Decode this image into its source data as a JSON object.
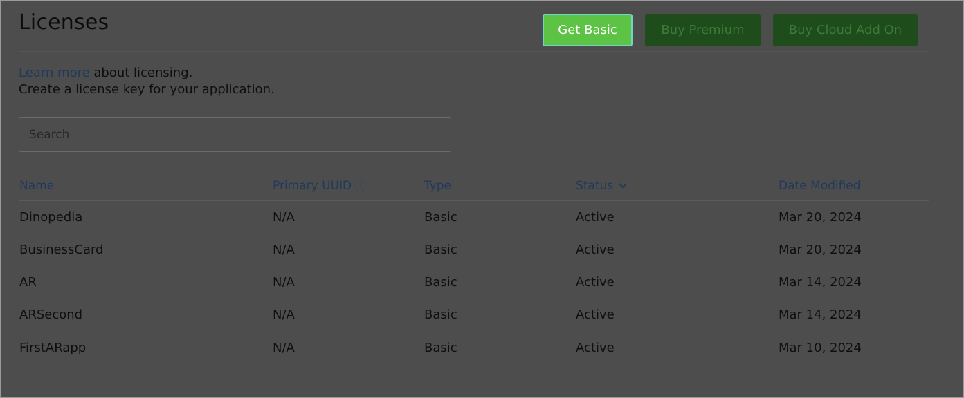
{
  "header": {
    "title": "Licenses",
    "buttons": {
      "get_basic": "Get Basic",
      "buy_premium": "Buy Premium",
      "buy_cloud": "Buy Cloud Add On"
    }
  },
  "intro": {
    "link_text": "Learn more",
    "line1_rest": " about licensing.",
    "line2": "Create a license key for your application."
  },
  "search": {
    "placeholder": "Search",
    "value": ""
  },
  "table": {
    "columns": {
      "name": "Name",
      "uuid": "Primary UUID",
      "type": "Type",
      "status": "Status",
      "date": "Date Modified"
    },
    "rows": [
      {
        "name": "Dinopedia",
        "uuid": "N/A",
        "type": "Basic",
        "status": "Active",
        "date": "Mar 20, 2024"
      },
      {
        "name": "BusinessCard",
        "uuid": "N/A",
        "type": "Basic",
        "status": "Active",
        "date": "Mar 20, 2024"
      },
      {
        "name": "AR",
        "uuid": "N/A",
        "type": "Basic",
        "status": "Active",
        "date": "Mar 14, 2024"
      },
      {
        "name": "ARSecond",
        "uuid": "N/A",
        "type": "Basic",
        "status": "Active",
        "date": "Mar 14, 2024"
      },
      {
        "name": "FirstARapp",
        "uuid": "N/A",
        "type": "Basic",
        "status": "Active",
        "date": "Mar 10, 2024"
      }
    ]
  },
  "icons": {
    "uuid_info": "info-icon",
    "status_sort": "chevron-down-icon"
  },
  "colors": {
    "accent_green": "#5dc344",
    "dim_green": "#1e4d1b",
    "link_blue": "#1f3a5c",
    "overlay": "#4d4d4d"
  }
}
